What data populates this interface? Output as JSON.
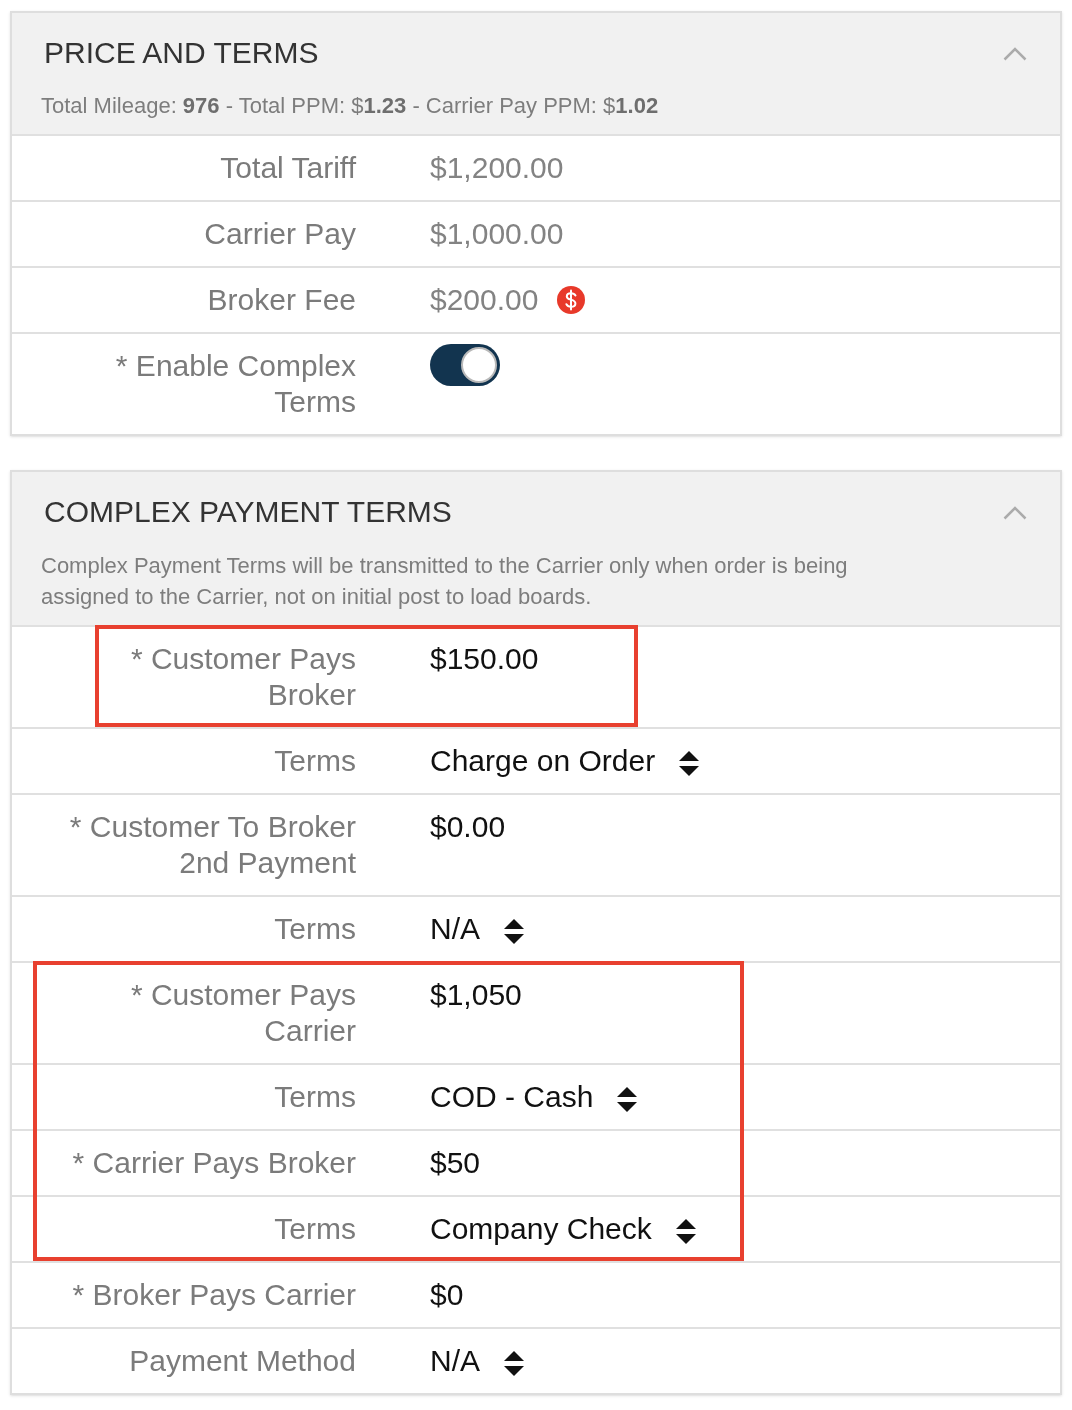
{
  "price_and_terms": {
    "title": "PRICE AND TERMS",
    "expanded": true,
    "summary": "Total Mileage: **976** - Total PPM: $**1.23** - Carrier Pay PPM: $**1.02**",
    "rows": [
      {
        "kind": "text",
        "label": "Total Tariff",
        "value": "$1,200.00"
      },
      {
        "kind": "text",
        "label": "Carrier Pay",
        "value": "$1,000.00"
      },
      {
        "kind": "fee",
        "label": "Broker Fee",
        "value": "$200.00"
      },
      {
        "kind": "toggle",
        "label": "* Enable Complex Terms",
        "on": true
      }
    ]
  },
  "complex_payment_terms": {
    "title": "COMPLEX PAYMENT TERMS",
    "expanded": true,
    "description": "Complex Payment Terms will be transmitted to the Carrier only when order is being assigned to the Carrier, not on initial post to load boards.",
    "items": [
      {
        "kind": "highlight",
        "rows": [
          {
            "kind": "input",
            "label": "* Customer Pays Broker",
            "value": "$150.00"
          }
        ]
      },
      {
        "kind": "select",
        "label": "Terms",
        "value": "Charge on Order"
      },
      {
        "kind": "input",
        "label": "* Customer To Broker 2nd Payment",
        "value": "$0.00"
      },
      {
        "kind": "select",
        "label": "Terms",
        "value": "N/A"
      },
      {
        "kind": "highlight",
        "rows": [
          {
            "kind": "input",
            "label": "* Customer Pays Carrier",
            "value": "$1,050"
          },
          {
            "kind": "select",
            "label": "Terms",
            "value": "COD - Cash"
          },
          {
            "kind": "input",
            "label": "* Carrier Pays Broker",
            "value": "$50"
          },
          {
            "kind": "select",
            "label": "Terms",
            "value": "Company Check"
          }
        ]
      },
      {
        "kind": "input",
        "label": "* Broker Pays Carrier",
        "value": "$0"
      },
      {
        "kind": "select",
        "label": "Payment Method",
        "value": "N/A"
      }
    ]
  }
}
